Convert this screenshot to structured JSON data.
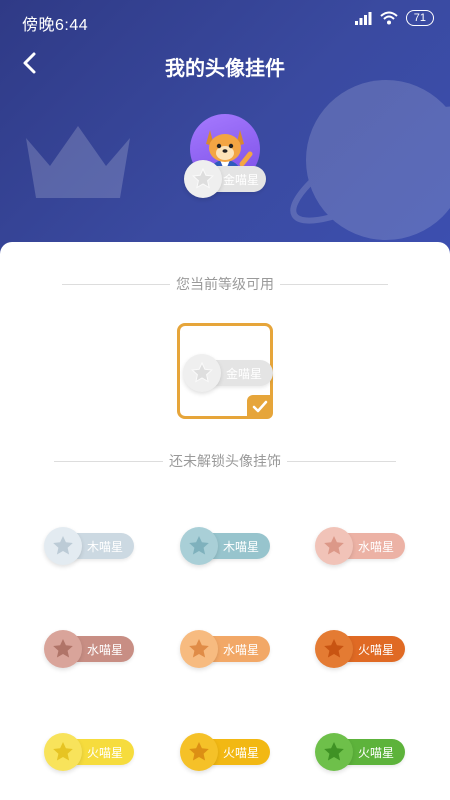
{
  "status_bar": {
    "time": "傍晚6:44",
    "battery": "71"
  },
  "header": {
    "title": "我的头像挂件"
  },
  "current_avatar": {
    "badge_label": "金喵星"
  },
  "available_section": {
    "heading": "您当前等级可用",
    "badge_label": "金喵星"
  },
  "locked_section": {
    "heading": "还未解锁头像挂饰",
    "badges": [
      {
        "label": "木喵星",
        "pill_color": "#ccd9e2",
        "circle_color": "#e3ebf1",
        "star_color": "#bccbd6"
      },
      {
        "label": "木喵星",
        "pill_color": "#97c4cd",
        "circle_color": "#a9cfd7",
        "star_color": "#7fb1bd"
      },
      {
        "label": "水喵星",
        "pill_color": "#ecb2a5",
        "circle_color": "#f1c3b8",
        "star_color": "#dc9888"
      },
      {
        "label": "水喵星",
        "pill_color": "#c88e84",
        "circle_color": "#d9a49a",
        "star_color": "#b07468"
      },
      {
        "label": "水喵星",
        "pill_color": "#f2a867",
        "circle_color": "#f7bb80",
        "star_color": "#e08c47"
      },
      {
        "label": "火喵星",
        "pill_color": "#e06a24",
        "circle_color": "#e47b33",
        "star_color": "#c85412"
      },
      {
        "label": "火喵星",
        "pill_color": "#f6dc3d",
        "circle_color": "#f8e35b",
        "star_color": "#e6c423"
      },
      {
        "label": "火喵星",
        "pill_color": "#f2b813",
        "circle_color": "#f5c128",
        "star_color": "#dc8f14"
      },
      {
        "label": "火喵星",
        "pill_color": "#5db33b",
        "circle_color": "#6ec04a",
        "star_color": "#3f9224"
      }
    ]
  }
}
